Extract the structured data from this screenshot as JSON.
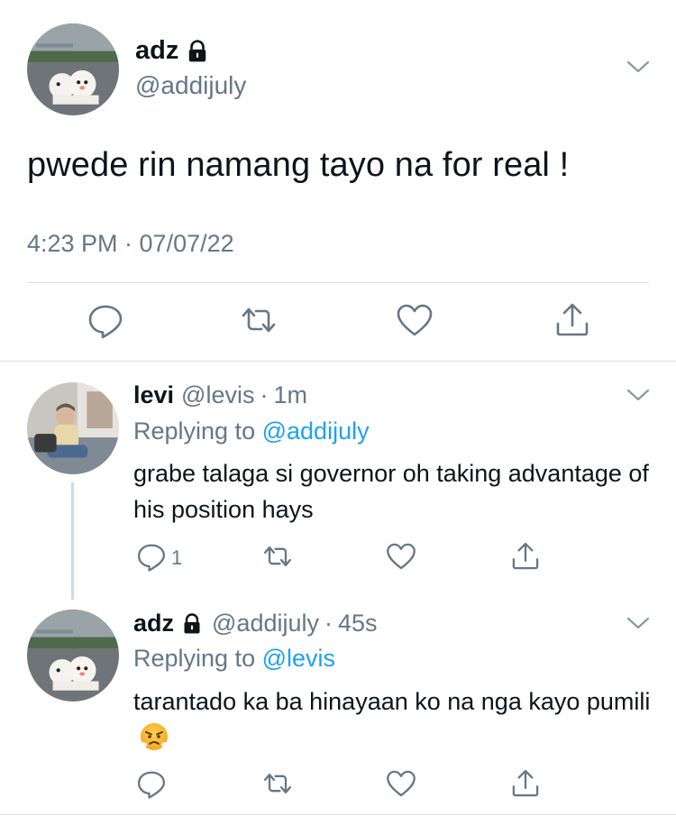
{
  "main_tweet": {
    "name": "adz",
    "handle": "@addijuly",
    "text": "pwede rin namang tayo na for real !",
    "meta": "4:23 PM · 07/07/22"
  },
  "replies": [
    {
      "name": "levi",
      "handle": "@levis",
      "separator": "·",
      "time": "1m",
      "replying_prefix": "Replying to",
      "replying_to": "@addijuly",
      "text": "grabe talaga si governor oh taking advantage of his position hays",
      "reply_count": "1"
    },
    {
      "name": "adz",
      "handle": "@addijuly",
      "separator": "·",
      "time": "45s",
      "replying_prefix": "Replying to",
      "replying_to": "@levis",
      "text": "tarantado ka ba hinayaan ko na nga kayo pumili"
    }
  ],
  "icons": [
    "lock-icon",
    "chevron-down-icon",
    "reply-icon",
    "retweet-icon",
    "like-icon",
    "share-icon",
    "angry-face-emoji"
  ],
  "colors": {
    "text": "#0f1419",
    "secondary": "#657786",
    "link": "#1da1f2",
    "divider": "#dcdfe3"
  }
}
